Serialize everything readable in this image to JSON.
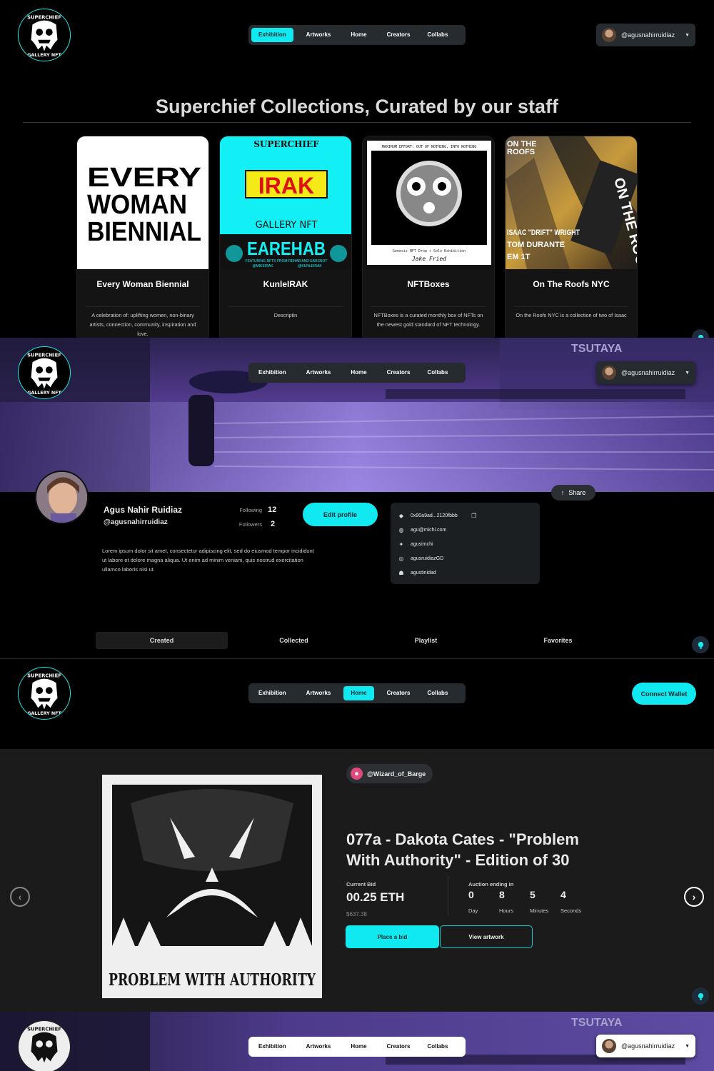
{
  "nav": {
    "items": [
      "Exhibition",
      "Artworks",
      "Home",
      "Creators",
      "Collabs"
    ]
  },
  "user": {
    "handle": "@agusnahirruidiaz"
  },
  "collections": {
    "heading": "Superchief Collections, Curated by our staff",
    "cards": [
      {
        "title": "Every Woman Biennial",
        "description": "A celebration of: uplifting women, non-binary artists, connection, community, inspiration and love.",
        "thumb_text": [
          "EVERY",
          "WOMAN",
          "BIENNIAL"
        ]
      },
      {
        "title": "KunleIRAK",
        "description": "Descriptin",
        "thumb_text": [
          "SUPERCHIEF",
          "IRAK",
          "GALLERY NFT",
          "EAREHAB",
          "FEATURING NFTS FROM REHAB AND EARSNOT",
          "@MIKEIRAK",
          "@KUNLEIRAK"
        ]
      },
      {
        "title": "NFTBoxes",
        "description": "NFTBoxes is a curated monthly box of NFTs on the newest gold standard of NFT technology.",
        "thumb_text": [
          "MAXIMUM EFFORT: OUT OF NOTHING, INTO NOTHING",
          "Genesis NFT Drop + Solo Exhibition",
          "Jake Fried"
        ]
      },
      {
        "title": "On The Roofs NYC",
        "description": "On the Roofs NYC is a collection of two of Isaac",
        "thumb_text": [
          "ON THE",
          "ROOFS",
          "ISAAC \"DRIFT\" WRIGHT",
          "TOM DURANTE",
          "EM 1T",
          "ON THE ROOFS"
        ]
      }
    ]
  },
  "logo_text": [
    "SUPERCHIEF",
    "GALLERY NFT"
  ],
  "banner_sign": "TSUTAYA",
  "profile": {
    "name": "Agus Nahir Ruidiaz",
    "handle": "@agusnahirruidiaz",
    "following_label": "Following",
    "following": "12",
    "followers_label": "Followers",
    "followers": "2",
    "edit_label": "Edit profile",
    "share_label": "Share",
    "bio": "Lorem ipsum dolor sit amet, consectetur adipiscing elit, sed do eiusmod tempor incididunt ut labore et dolore magna aliqua. Ut enim ad minim veniam, quis nostrud exercitation ullamco laboris nisi ut.",
    "socials": [
      {
        "icon": "ethereum-icon",
        "value": "0x90a9ad...2120fbbb"
      },
      {
        "icon": "globe-icon",
        "value": "agu@michi.com"
      },
      {
        "icon": "twitter-icon",
        "value": "agusimchi"
      },
      {
        "icon": "instagram-icon",
        "value": "agusruidiazGD"
      },
      {
        "icon": "snapchat-icon",
        "value": "agustinidad"
      }
    ],
    "tabs": [
      "Created",
      "Collected",
      "Playlist",
      "Favorites"
    ]
  },
  "auction": {
    "connect_label": "Connect Wallet",
    "creator": "@Wizard_of_Barge",
    "title": "077a - Dakota Cates - \"Problem With Authority\" - Edition of 30",
    "current_bid_label": "Current Bid",
    "current_bid": "00.25 ETH",
    "usd": "$637.38",
    "ending_label": "Auction ending in",
    "countdown": [
      {
        "value": "0",
        "unit": "Day"
      },
      {
        "value": "8",
        "unit": "Hours"
      },
      {
        "value": "5",
        "unit": "Minutes"
      },
      {
        "value": "4",
        "unit": "Seconds"
      }
    ],
    "place_bid_label": "Place a bid",
    "view_label": "View artwork",
    "art_caption": "PROBLEM WITH AUTHORITY"
  },
  "colors": {
    "accent": "#11e9f0",
    "panel": "#262b30",
    "hero_bg": "#1b1b1b"
  }
}
